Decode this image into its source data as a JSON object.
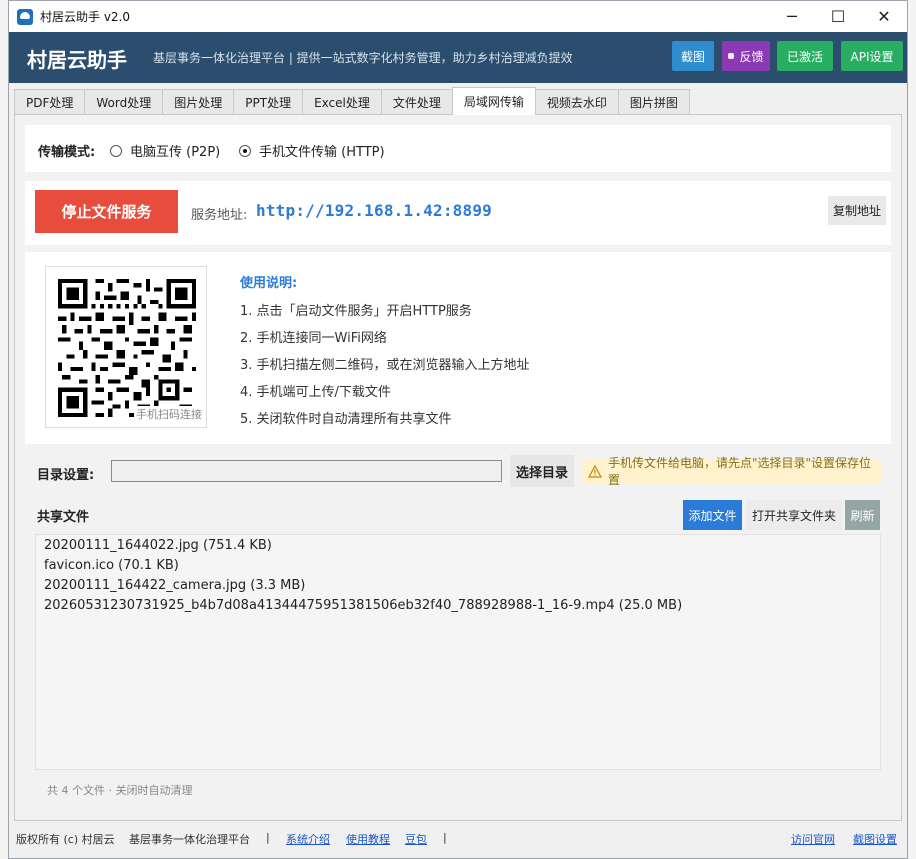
{
  "window": {
    "title": "村居云助手 v2.0",
    "controls": {
      "minimize": "─",
      "maximize": "☐",
      "close": "✕"
    }
  },
  "header": {
    "brand": "村居云助手",
    "slogan": "基层事务一体化治理平台 | 提供一站式数字化村务管理，助力乡村治理减负提效",
    "buttons": {
      "screenshot": "截图",
      "feedback": "反馈",
      "activated": "已激活",
      "api_settings": "API设置"
    },
    "colors": {
      "banner": "#2b4d6e",
      "screenshot": "#2f8ccf",
      "feedback": "#8b39b5",
      "green": "#27ae60"
    }
  },
  "tabs": [
    {
      "label": "PDF处理",
      "active": false
    },
    {
      "label": "Word处理",
      "active": false
    },
    {
      "label": "图片处理",
      "active": false
    },
    {
      "label": "PPT处理",
      "active": false
    },
    {
      "label": "Excel处理",
      "active": false
    },
    {
      "label": "文件处理",
      "active": false
    },
    {
      "label": "局域网传输",
      "active": true
    },
    {
      "label": "视频去水印",
      "active": false
    },
    {
      "label": "图片拼图",
      "active": false
    }
  ],
  "transfer": {
    "mode_label": "传输模式:",
    "modes": [
      {
        "label": "电脑互传 (P2P)",
        "selected": false
      },
      {
        "label": "手机文件传输 (HTTP)",
        "selected": true
      }
    ],
    "stop_button": "停止文件服务",
    "address_label": "服务地址:",
    "address": "http://192.168.1.42:8899",
    "copy_button": "复制地址",
    "qr_caption": "手机扫码连接",
    "instructions_title": "使用说明:",
    "instructions": [
      "1. 点击「启动文件服务」开启HTTP服务",
      "2. 手机连接同一WiFi网络",
      "3. 手机扫描左侧二维码，或在浏览器输入上方地址",
      "4. 手机端可上传/下载文件",
      "5. 关闭软件时自动清理所有共享文件"
    ],
    "dir_label": "目录设置:",
    "dir_value": "",
    "select_dir_button": "选择目录",
    "tip": "手机传文件给电脑，请先点\"选择目录\"设置保存位置",
    "shared_title": "共享文件",
    "add_button": "添加文件",
    "open_folder_button": "打开共享文件夹",
    "refresh_button": "刷新",
    "files": [
      "20200111_1644022.jpg  (751.4 KB)",
      "favicon.ico  (70.1 KB)",
      "20200111_164422_camera.jpg  (3.3 MB)",
      "20260531230731925_b4b7d08a41344475951381506eb32f40_788928988-1_16-9.mp4  (25.0 MB)"
    ],
    "footer": "共 4 个文件 · 关闭时自动清理",
    "accent_color": "#2c7bd8",
    "stop_color": "#e74c3c"
  },
  "statusbar": {
    "copyright": "版权所有 (c) 村居云",
    "platform": "基层事务一体化治理平台",
    "sep": "|",
    "links": [
      "系统介绍",
      "使用教程",
      "豆包"
    ],
    "right_links": [
      "访问官网",
      "截图设置"
    ]
  }
}
